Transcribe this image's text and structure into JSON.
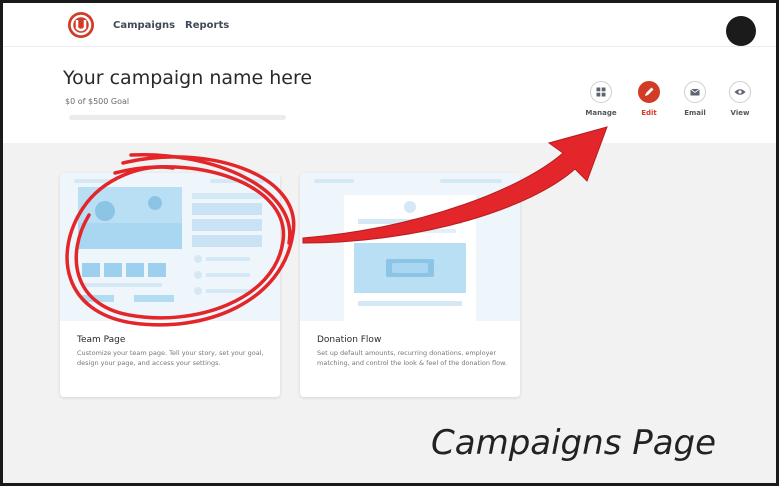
{
  "nav": {
    "logo_icon": "brand-logo-icon",
    "links": [
      {
        "label": "Campaigns"
      },
      {
        "label": "Reports"
      }
    ],
    "avatar_icon": "user-avatar"
  },
  "campaign": {
    "title": "Your campaign name here",
    "goal_text": "$0 of $500 Goal",
    "progress": 0,
    "actions": [
      {
        "label": "Manage",
        "icon": "grid-icon",
        "active": false
      },
      {
        "label": "Edit",
        "icon": "pencil-icon",
        "active": true
      },
      {
        "label": "Email",
        "icon": "envelope-icon",
        "active": false
      },
      {
        "label": "View",
        "icon": "eye-icon",
        "active": false
      }
    ]
  },
  "cards": [
    {
      "title": "Team Page",
      "description": "Customize your team page. Tell your story, set your goal, design your page, and access your settings."
    },
    {
      "title": "Donation Flow",
      "description": "Set up default amounts, recurring donations, employer matching, and control the look & feel of the donation flow."
    }
  ],
  "caption": "Campaigns Page",
  "colors": {
    "accent": "#d23b25",
    "annotation": "#e3262a",
    "preview_bg": "#eaf4fb",
    "preview_blue": "#a9d6f0"
  }
}
